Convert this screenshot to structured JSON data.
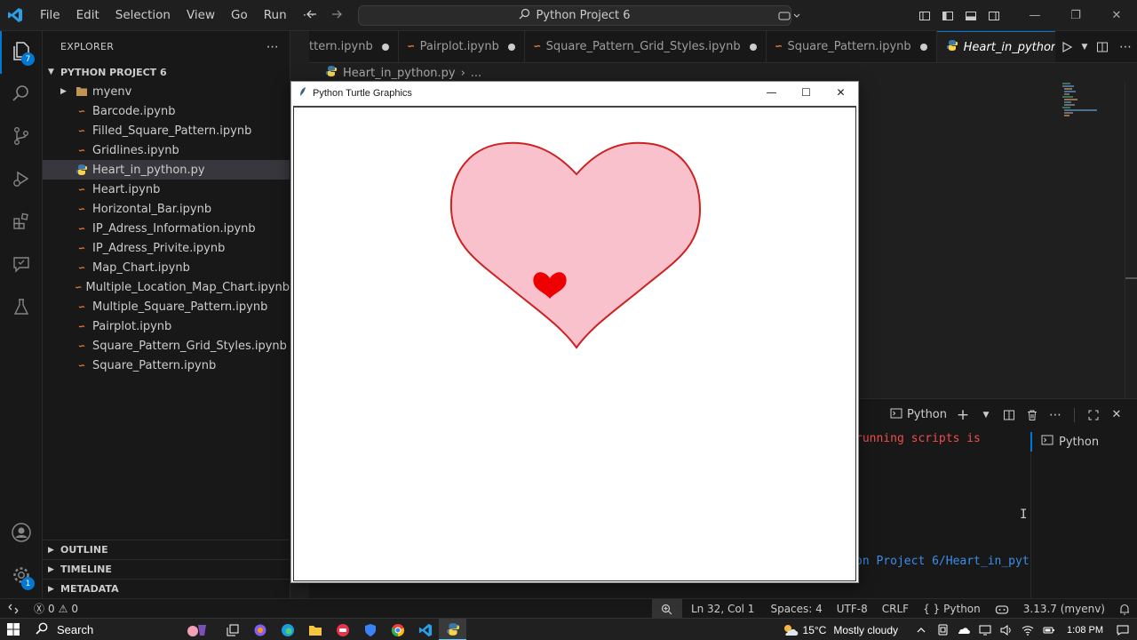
{
  "titlebar": {
    "menu": [
      "File",
      "Edit",
      "Selection",
      "View",
      "Go",
      "Run",
      "⋯"
    ],
    "search_text": "Python Project 6"
  },
  "activity": {
    "explorer_badge": "7",
    "settings_badge": "1"
  },
  "sidebar": {
    "title": "EXPLORER",
    "project": "PYTHON PROJECT 6",
    "items": [
      {
        "label": "myenv",
        "type": "folder"
      },
      {
        "label": "Barcode.ipynb",
        "type": "notebook"
      },
      {
        "label": "Filled_Square_Pattern.ipynb",
        "type": "notebook"
      },
      {
        "label": "Gridlines.ipynb",
        "type": "notebook"
      },
      {
        "label": "Heart_in_python.py",
        "type": "python",
        "selected": true
      },
      {
        "label": "Heart.ipynb",
        "type": "notebook"
      },
      {
        "label": "Horizontal_Bar.ipynb",
        "type": "notebook"
      },
      {
        "label": "IP_Adress_Information.ipynb",
        "type": "notebook"
      },
      {
        "label": "IP_Adress_Privite.ipynb",
        "type": "notebook"
      },
      {
        "label": "Map_Chart.ipynb",
        "type": "notebook"
      },
      {
        "label": "Multiple_Location_Map_Chart.ipynb",
        "type": "notebook"
      },
      {
        "label": "Multiple_Square_Pattern.ipynb",
        "type": "notebook"
      },
      {
        "label": "Pairplot.ipynb",
        "type": "notebook"
      },
      {
        "label": "Square_Pattern_Grid_Styles.ipynb",
        "type": "notebook"
      },
      {
        "label": "Square_Pattern.ipynb",
        "type": "notebook"
      }
    ],
    "outline": "OUTLINE",
    "timeline": "TIMELINE",
    "metadata": "METADATA"
  },
  "tabs": [
    {
      "label": "ttern.ipynb",
      "modified": true
    },
    {
      "label": "Pairplot.ipynb",
      "modified": true
    },
    {
      "label": "Square_Pattern_Grid_Styles.ipynb",
      "modified": true
    },
    {
      "label": "Square_Pattern.ipynb",
      "modified": true
    },
    {
      "label": "Heart_in_python.py",
      "active": true
    }
  ],
  "breadcrumb": {
    "file": "Heart_in_python.py",
    "more": "..."
  },
  "turtle_window": {
    "title": "Python Turtle Graphics"
  },
  "panel": {
    "shell_label": "Python",
    "term_line1": "running scripts is",
    "term_line2": "on Project 6/Heart_in_pyt",
    "term_list_item": "Python"
  },
  "statusbar": {
    "errors": "0",
    "warnings": "0",
    "position": "Ln 32, Col 1",
    "spaces": "Spaces: 4",
    "encoding": "UTF-8",
    "eol": "CRLF",
    "language": "Python",
    "interpreter": "3.13.7 (myenv)"
  },
  "taskbar": {
    "search": "Search",
    "weather": "15°C",
    "weather_desc": "Mostly cloudy",
    "time": "1:08 PM"
  },
  "colors": {
    "accent": "#0078d4",
    "heart_fill": "#f9c1cc",
    "heart_outline": "#cc2222",
    "small_heart": "#ee0000"
  }
}
